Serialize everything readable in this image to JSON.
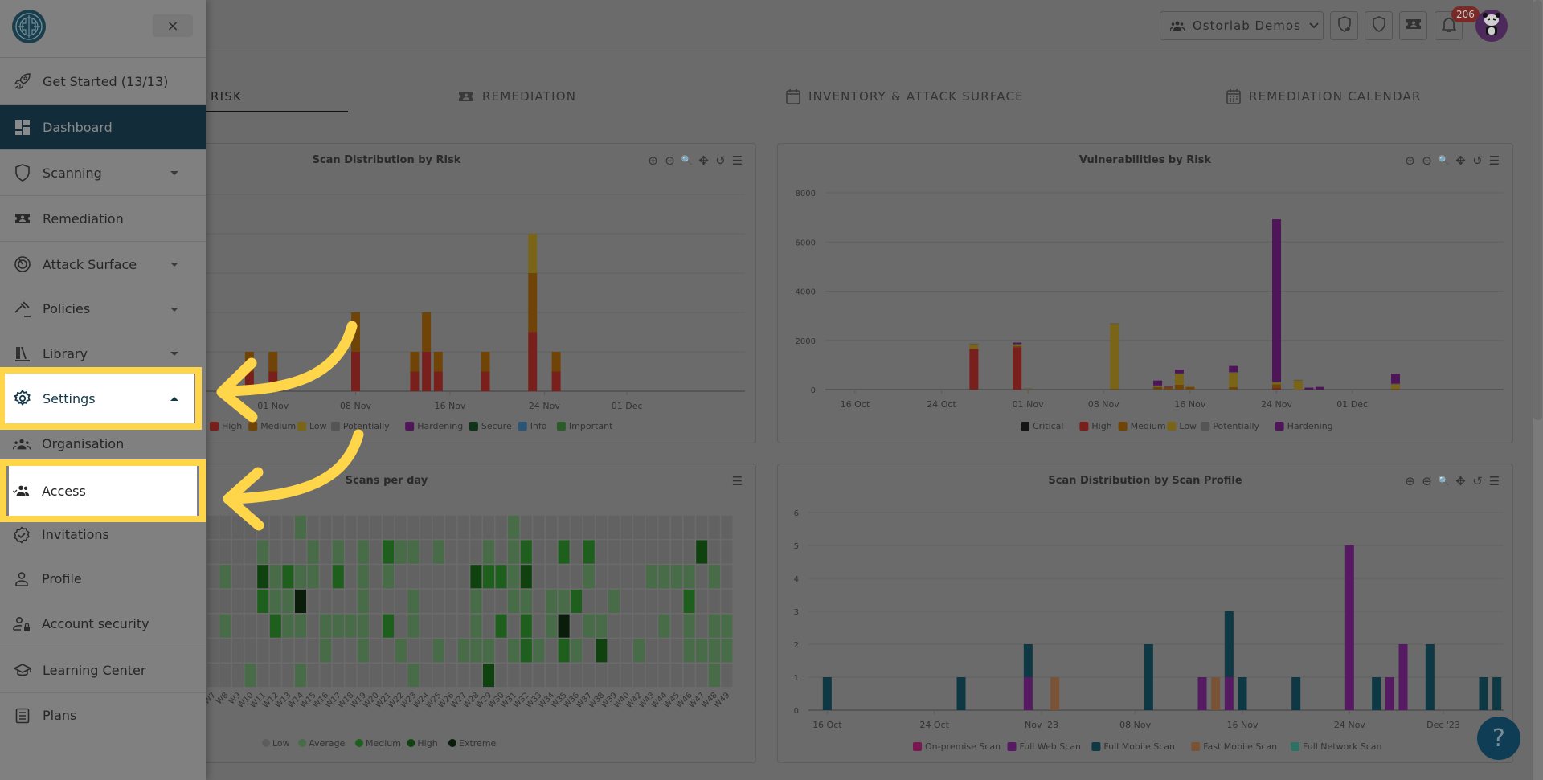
{
  "header": {
    "org_selector": {
      "icon": "group-icon",
      "label": "Ostorlab Demos",
      "chevron": "chevron-down-icon"
    },
    "buttons": [
      {
        "name": "new-scan-button",
        "icon": "shield-plus-icon"
      },
      {
        "name": "security-button",
        "icon": "shield-icon"
      },
      {
        "name": "tickets-button",
        "icon": "ticket-icon"
      },
      {
        "name": "notifications-button",
        "icon": "bell-icon"
      }
    ],
    "notification_count": "206",
    "avatar": "panda-avatar"
  },
  "tabs": [
    {
      "label": "RISK",
      "icon": "alert-icon",
      "active": true
    },
    {
      "label": "REMEDIATION",
      "icon": "ticket-icon",
      "active": false
    },
    {
      "label": "INVENTORY & ATTACK SURFACE",
      "icon": "calendar-icon",
      "active": false
    },
    {
      "label": "REMEDIATION CALENDAR",
      "icon": "calendar-grid-icon",
      "active": false
    }
  ],
  "sidebar": {
    "close_label": "×",
    "items": [
      {
        "label": "Get Started (13/13)",
        "icon": "rocket-icon"
      },
      {
        "label": "Dashboard",
        "icon": "dashboard-icon",
        "active": true
      },
      {
        "label": "Scanning",
        "icon": "shield-icon",
        "expandable": true
      },
      {
        "label": "Remediation",
        "icon": "ticket-icon"
      },
      {
        "label": "Attack Surface",
        "icon": "radar-icon",
        "expandable": true
      },
      {
        "label": "Policies",
        "icon": "gavel-icon",
        "expandable": true
      },
      {
        "label": "Library",
        "icon": "library-icon",
        "expandable": true
      },
      {
        "label": "Settings",
        "icon": "gear-icon",
        "expandable": true,
        "expanded": true,
        "highlighted": true
      },
      {
        "label": "Organisation",
        "icon": "group-icon",
        "sub": true
      },
      {
        "label": "Access",
        "icon": "people-check-icon",
        "sub": true,
        "highlighted": true
      },
      {
        "label": "Invitations",
        "icon": "badge-check-icon",
        "sub": true
      },
      {
        "label": "Profile",
        "icon": "person-icon",
        "sub": true
      },
      {
        "label": "Account security",
        "icon": "person-lock-icon",
        "sub": true
      },
      {
        "label": "Learning Center",
        "icon": "graduation-cap-icon"
      },
      {
        "label": "Plans",
        "icon": "receipt-icon"
      }
    ]
  },
  "help_label": "?",
  "colors": {
    "highlight": "#ffd54a",
    "sidebar_active": "#132c3a",
    "high": "#7a201c",
    "medium": "#704406",
    "low": "#7a6418",
    "potentially": "#555555",
    "hardening": "#4f1559",
    "secure": "#10331a",
    "info": "#2a5577",
    "important": "#2b5a2b",
    "critical": "#151515",
    "full_mobile": "#0d3844",
    "full_web": "#561a62",
    "fast_mobile": "#7a5236",
    "on_premise": "#7a1650",
    "full_network": "#2f7064"
  },
  "chart_data": [
    {
      "type": "bar",
      "stacked": true,
      "title": "Scan Distribution by Risk",
      "x_ticks": [
        "01 Nov",
        "08 Nov",
        "16 Nov",
        "24 Nov",
        "01 Dec"
      ],
      "categories": [
        "30 Oct",
        "01 Nov",
        "08 Nov",
        "13 Nov",
        "14 Nov",
        "15 Nov",
        "19 Nov",
        "23 Nov",
        "25 Nov"
      ],
      "series": [
        {
          "name": "High",
          "values": [
            0.5,
            0.5,
            1,
            0.5,
            1,
            0.5,
            0.5,
            1.5,
            0.5
          ]
        },
        {
          "name": "Medium",
          "values": [
            0.5,
            0.5,
            1,
            0.5,
            1,
            0.5,
            0.5,
            1.5,
            0.5
          ]
        },
        {
          "name": "Low",
          "values": [
            0,
            0,
            0,
            0,
            0,
            0,
            0,
            1,
            0
          ]
        },
        {
          "name": "Potentially",
          "values": [
            0,
            0,
            0,
            0,
            0,
            0,
            0,
            0,
            0
          ]
        },
        {
          "name": "Hardening",
          "values": [
            0,
            0,
            0,
            0,
            0,
            0,
            0,
            0,
            0
          ]
        },
        {
          "name": "Secure",
          "values": [
            0,
            0,
            0,
            0,
            0,
            0,
            0,
            0,
            0
          ]
        },
        {
          "name": "Info",
          "values": [
            0,
            0,
            0,
            0,
            0,
            0,
            0,
            0,
            0
          ]
        },
        {
          "name": "Important",
          "values": [
            0,
            0,
            0,
            0,
            0,
            0,
            0,
            0,
            0
          ]
        }
      ],
      "ylim": [
        0,
        5
      ],
      "legend": [
        "High",
        "Medium",
        "Low",
        "Potentially",
        "Hardening",
        "Secure",
        "Info",
        "Important"
      ],
      "legend_position": "bottom",
      "grid": true
    },
    {
      "type": "bar",
      "stacked": true,
      "title": "Vulnerabilities by Risk",
      "y_ticks": [
        "0",
        "2000",
        "4000",
        "6000",
        "8000"
      ],
      "x_ticks": [
        "16 Oct",
        "24 Oct",
        "01 Nov",
        "08 Nov",
        "16 Nov",
        "24 Nov",
        "01 Dec"
      ],
      "categories": [
        "27 Oct",
        "31 Oct",
        "01 Nov",
        "09 Nov",
        "13 Nov",
        "14 Nov",
        "15 Nov",
        "16 Nov",
        "20 Nov",
        "24 Nov",
        "26 Nov",
        "27 Nov",
        "28 Nov",
        "05 Dec"
      ],
      "series": [
        {
          "name": "Critical",
          "values": [
            0,
            0,
            0,
            0,
            0,
            0,
            0,
            0,
            0,
            0,
            0,
            0,
            0,
            0
          ]
        },
        {
          "name": "High",
          "values": [
            1650,
            1720,
            0,
            0,
            0,
            0,
            0,
            0,
            0,
            60,
            0,
            0,
            0,
            0
          ]
        },
        {
          "name": "Medium",
          "values": [
            0,
            50,
            30,
            30,
            100,
            100,
            200,
            100,
            100,
            150,
            0,
            0,
            0,
            30
          ]
        },
        {
          "name": "Low",
          "values": [
            200,
            60,
            10,
            2650,
            60,
            30,
            450,
            50,
            600,
            100,
            380,
            0,
            0,
            200
          ]
        },
        {
          "name": "Potentially",
          "values": [
            20,
            20,
            10,
            20,
            10,
            10,
            10,
            10,
            10,
            10,
            20,
            0,
            0,
            10
          ]
        },
        {
          "name": "Hardening",
          "values": [
            0,
            60,
            0,
            0,
            200,
            10,
            150,
            0,
            250,
            6600,
            0,
            80,
            110,
            400
          ]
        }
      ],
      "ylim": [
        0,
        8000
      ],
      "legend": [
        "Critical",
        "High",
        "Medium",
        "Low",
        "Potentially",
        "Hardening"
      ],
      "legend_position": "bottom",
      "grid": true
    },
    {
      "type": "heatmap",
      "title": "Scans per day",
      "x_labels": [
        "W7",
        "W8",
        "W9",
        "W10",
        "W11",
        "W12",
        "W13",
        "W14",
        "W15",
        "W16",
        "W17",
        "W18",
        "W19",
        "W20",
        "W21",
        "W22",
        "W23",
        "W24",
        "W25",
        "W26",
        "W27",
        "W28",
        "W29",
        "W30",
        "W31",
        "W32",
        "W33",
        "W34",
        "W35",
        "W36",
        "W37",
        "W38",
        "W39",
        "W40",
        "W42",
        "W43",
        "W44",
        "W45",
        "W46",
        "W47",
        "W48",
        "W49"
      ],
      "levels": [
        "Low",
        "Average",
        "Medium",
        "High",
        "Extreme"
      ],
      "rows": [
        [
          0,
          0,
          0,
          0,
          0,
          0,
          0,
          1,
          0,
          0,
          0,
          0,
          0,
          0,
          0,
          0,
          0,
          0,
          0,
          0,
          0,
          0,
          0,
          0,
          1,
          0,
          0,
          0,
          0,
          0,
          0,
          0,
          0,
          0,
          0,
          0,
          0,
          0,
          0,
          0,
          0,
          0
        ],
        [
          0,
          0,
          0,
          0,
          1,
          0,
          0,
          0,
          1,
          0,
          1,
          0,
          1,
          0,
          2,
          1,
          1,
          0,
          1,
          0,
          0,
          0,
          1,
          0,
          1,
          2,
          0,
          0,
          2,
          0,
          2,
          0,
          0,
          0,
          0,
          0,
          0,
          0,
          0,
          3,
          0,
          0
        ],
        [
          0,
          1,
          0,
          0,
          3,
          1,
          2,
          1,
          1,
          0,
          2,
          0,
          1,
          0,
          1,
          0,
          0,
          0,
          0,
          0,
          0,
          3,
          2,
          2,
          1,
          3,
          0,
          0,
          0,
          0,
          1,
          0,
          0,
          0,
          0,
          1,
          1,
          1,
          1,
          0,
          1,
          0
        ],
        [
          0,
          0,
          0,
          0,
          2,
          1,
          1,
          4,
          0,
          0,
          0,
          0,
          1,
          0,
          0,
          0,
          1,
          0,
          0,
          0,
          0,
          1,
          0,
          0,
          1,
          1,
          0,
          1,
          1,
          2,
          0,
          0,
          1,
          0,
          0,
          0,
          0,
          0,
          2,
          0,
          0,
          0
        ],
        [
          0,
          1,
          0,
          0,
          0,
          2,
          1,
          1,
          0,
          1,
          1,
          1,
          1,
          0,
          2,
          0,
          1,
          0,
          0,
          0,
          0,
          1,
          0,
          2,
          0,
          2,
          0,
          1,
          4,
          0,
          1,
          1,
          0,
          0,
          0,
          0,
          1,
          0,
          1,
          0,
          1,
          1
        ],
        [
          0,
          0,
          0,
          0,
          0,
          0,
          0,
          0,
          0,
          1,
          0,
          0,
          1,
          0,
          0,
          1,
          0,
          0,
          1,
          0,
          1,
          1,
          1,
          0,
          1,
          2,
          1,
          0,
          2,
          1,
          0,
          3,
          0,
          0,
          1,
          0,
          0,
          0,
          1,
          1,
          1,
          1
        ],
        [
          0,
          0,
          0,
          1,
          0,
          0,
          0,
          1,
          0,
          0,
          0,
          0,
          0,
          0,
          0,
          0,
          1,
          0,
          0,
          0,
          0,
          0,
          3,
          0,
          0,
          0,
          0,
          0,
          0,
          0,
          0,
          0,
          0,
          0,
          0,
          0,
          0,
          0,
          0,
          0,
          1,
          0
        ]
      ],
      "legend_position": "bottom"
    },
    {
      "type": "bar",
      "stacked": true,
      "title": "Scan Distribution by Scan Profile",
      "y_ticks": [
        "0",
        "1",
        "2",
        "3",
        "4",
        "5",
        "6"
      ],
      "x_ticks": [
        "16 Oct",
        "24 Oct",
        "Nov '23",
        "08 Nov",
        "16 Nov",
        "24 Nov",
        "Dec '23"
      ],
      "categories": [
        "16 Oct",
        "26 Oct",
        "31 Oct",
        "02 Nov",
        "09 Nov",
        "13 Nov",
        "14 Nov",
        "15 Nov",
        "16 Nov",
        "20 Nov",
        "24 Nov",
        "26 Nov",
        "27 Nov",
        "28 Nov",
        "30 Nov",
        "04 Dec",
        "05 Dec"
      ],
      "series": [
        {
          "name": "On-premise Scan",
          "values": [
            0,
            0,
            0,
            0,
            0,
            0,
            0,
            0,
            0,
            0,
            0,
            0,
            0,
            0,
            0,
            0,
            0
          ]
        },
        {
          "name": "Full Web Scan",
          "values": [
            0,
            0,
            1,
            0,
            0,
            1,
            0,
            1,
            0,
            0,
            5,
            0,
            1,
            2,
            0,
            0,
            0
          ]
        },
        {
          "name": "Full Mobile Scan",
          "values": [
            1,
            1,
            1,
            0,
            2,
            0,
            0,
            2,
            1,
            1,
            0,
            1,
            0,
            0,
            2,
            1,
            1
          ]
        },
        {
          "name": "Fast Mobile Scan",
          "values": [
            0,
            0,
            0,
            1,
            0,
            0,
            1,
            0,
            0,
            0,
            0,
            0,
            0,
            0,
            0,
            0,
            0
          ]
        },
        {
          "name": "Full Network Scan",
          "values": [
            0,
            0,
            0,
            0,
            0,
            0,
            0,
            0,
            0,
            0,
            0,
            0,
            0,
            0,
            0,
            0,
            0
          ]
        }
      ],
      "ylim": [
        0,
        6
      ],
      "legend": [
        "On-premise Scan",
        "Full Web Scan",
        "Full Mobile Scan",
        "Fast Mobile Scan",
        "Full Network Scan"
      ],
      "legend_position": "bottom",
      "grid": true
    }
  ]
}
